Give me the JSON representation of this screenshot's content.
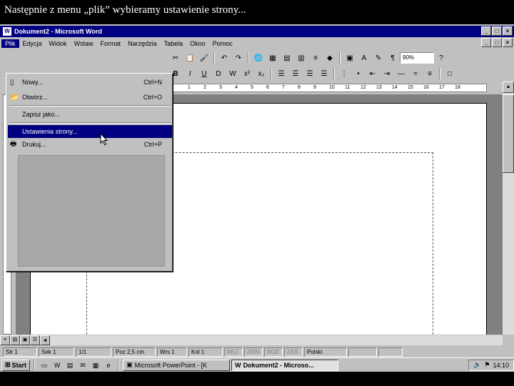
{
  "caption": "Następnie z menu „plik” wybieramy ustawienie strony...",
  "window": {
    "title": "Dokument2 - Microsoft Word",
    "app_icon": "W",
    "min": "_",
    "max": "□",
    "close": "×"
  },
  "menubar": [
    "Plik",
    "Edycja",
    "Widok",
    "Wstaw",
    "Format",
    "Narzędzia",
    "Tabela",
    "Okno",
    "Pomoc"
  ],
  "toolbar": {
    "zoom": "90%"
  },
  "ruler_numbers": [
    "1",
    "2",
    "3",
    "4",
    "5",
    "6",
    "7",
    "8",
    "9",
    "10",
    "11",
    "12",
    "13",
    "14",
    "15",
    "16",
    "17",
    "18"
  ],
  "file_menu": {
    "items": [
      {
        "label": "Nowy...",
        "shortcut": "Ctrl+N",
        "icon": "new-document-icon"
      },
      {
        "label": "Otwórz...",
        "shortcut": "Ctrl+O",
        "icon": "open-folder-icon"
      },
      {
        "label": "Zapisz jako...",
        "shortcut": "",
        "icon": ""
      },
      {
        "label": "Ustawienia strony...",
        "shortcut": "",
        "icon": "",
        "highlighted": true
      },
      {
        "label": "Drukuj...",
        "shortcut": "Ctrl+P",
        "icon": "print-icon"
      }
    ]
  },
  "statusbar": {
    "page": "Str 1",
    "section": "Sek 1",
    "pages": "1/1",
    "position": "Poz 2,5 cm",
    "line": "Wrs 1",
    "column": "Kol 1",
    "rec": "REJ",
    "trk": "ZMN",
    "ext": "ROZ",
    "ovr": "ZAS",
    "language": "Polski"
  },
  "taskbar": {
    "start": "Start",
    "tasks": [
      {
        "label": "Microsoft PowerPoint - [K",
        "pressed": false
      },
      {
        "label": "Dokument2 - Microso...",
        "pressed": true
      }
    ],
    "clock": "14:10"
  }
}
